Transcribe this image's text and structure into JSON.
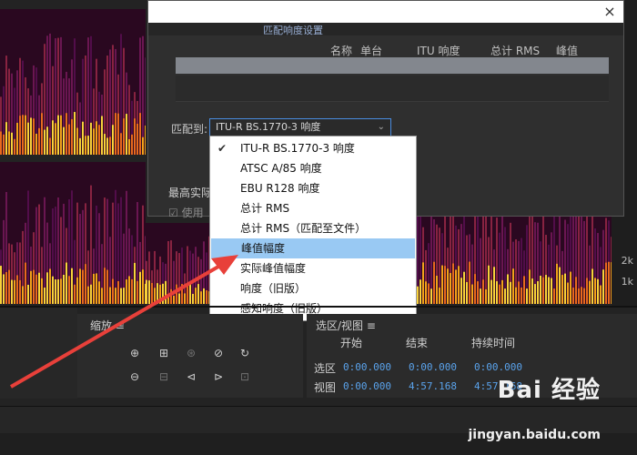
{
  "ruler": {
    "labels": [
      "2k",
      "1k"
    ]
  },
  "dialog": {
    "tab_label": "匹配响度设置",
    "headers": [
      "名称",
      "单台",
      "ITU 响度",
      "总计 RMS",
      "峰值"
    ],
    "match_label": "匹配到:",
    "match_value": "ITU-R BS.1770-3 响度",
    "max_label": "最高实际",
    "use_label": "使用",
    "close_glyph": "×"
  },
  "menu": {
    "selected_index": 5,
    "items": [
      {
        "label": "ITU-R BS.1770-3 响度",
        "checked": true
      },
      {
        "label": "ATSC A/85 响度",
        "checked": false
      },
      {
        "label": "EBU R128 响度",
        "checked": false
      },
      {
        "label": "总计 RMS",
        "checked": false
      },
      {
        "label": "总计 RMS（匹配至文件）",
        "checked": false
      },
      {
        "label": "峰值幅度",
        "checked": false
      },
      {
        "label": "实际峰值幅度",
        "checked": false
      },
      {
        "label": "响度（旧版）",
        "checked": false
      },
      {
        "label": "感知响度（旧版）",
        "checked": false
      }
    ]
  },
  "zoom_panel": {
    "title": "缩放",
    "menu_glyph": "≡"
  },
  "selection_panel": {
    "title": "选区/视图",
    "menu_glyph": "≡",
    "columns": [
      "开始",
      "结束",
      "持续时间"
    ],
    "rows": [
      {
        "label": "选区",
        "start": "0:00.000",
        "end": "0:00.000",
        "duration": "0:00.000"
      },
      {
        "label": "视图",
        "start": "0:00.000",
        "end": "4:57.168",
        "duration": "4:57.168"
      }
    ]
  },
  "watermark": {
    "brand": "Bai 经验",
    "url": "jingyan.baidu.com"
  },
  "colors": {
    "accent": "#5aa3ec",
    "selected_item": "#99c9f3",
    "arrow": "#e8403a"
  }
}
